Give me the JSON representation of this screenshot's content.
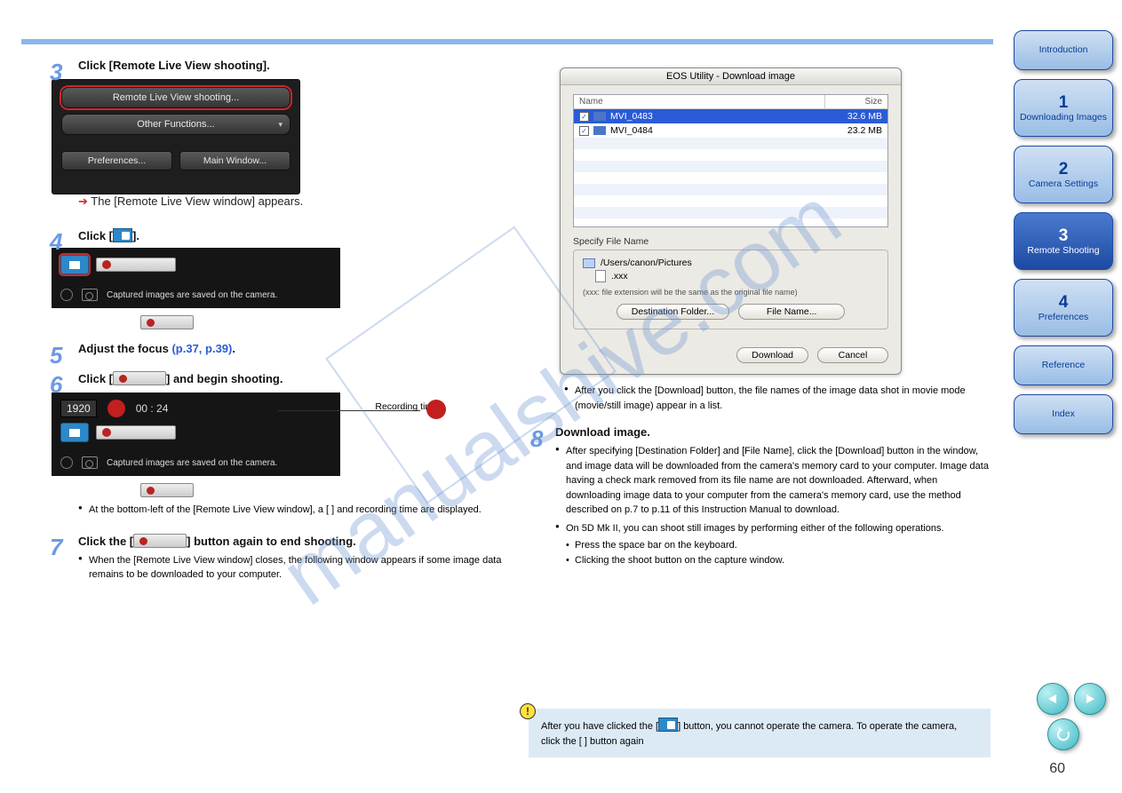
{
  "watermark": "manualshive.com",
  "page_number": "60",
  "sidetabs": [
    {
      "num": "",
      "label": "Introduction"
    },
    {
      "num": "1",
      "label": "Downloading Images"
    },
    {
      "num": "2",
      "label": "Camera Settings"
    },
    {
      "num": "3",
      "label": "Remote Shooting"
    },
    {
      "num": "4",
      "label": "Preferences"
    },
    {
      "num": "",
      "label": "Reference"
    },
    {
      "num": "",
      "label": "Index"
    }
  ],
  "cap_panel": {
    "remote": "Remote Live View shooting...",
    "other": "Other Functions...",
    "prefs": "Preferences...",
    "main": "Main Window..."
  },
  "steps": {
    "s3": {
      "title": "Click [Remote Live View shooting].",
      "after": "The [Remote Live View window] appears."
    },
    "s4": {
      "title_pre": "Click [",
      "title_post": "]."
    },
    "s5": {
      "title_pre": "Adjust the focus ",
      "title_link": "(p.37, p.39)",
      "title_post": "."
    },
    "s6": {
      "title_pre": "Click [",
      "title_post": "] and begin shooting."
    },
    "s7": {
      "title_pre": "Click the [",
      "title_post": "] button again to end shooting."
    },
    "s8": {
      "title": "Download image."
    }
  },
  "rec_panel": {
    "msg": "Captured images are saved on the camera."
  },
  "rec_time": {
    "res": "1920",
    "time": "00 : 24",
    "label": "Recording time"
  },
  "notes6": [
    "At the bottom-left of the [Remote Live View window], a [   ] and recording time are displayed."
  ],
  "notes7": [
    "When the [Remote Live View window] closes, the following window appears if some image data remains to be downloaded to your computer."
  ],
  "notes8": [
    "After you click the [Download] button, the file names of the image data shot in movie mode (movie/still image) appear in a list.",
    "After specifying [Destination Folder] and [File Name], click the [Download] button in the window, and image data will be downloaded from the camera's memory card to your computer. Image data having a check mark removed from its file name are not downloaded. Afterward, when downloading image data to your computer from the camera's memory card, use the method described on p.7 to p.11 of this Instruction Manual to download.",
    "On 5D Mk II, you can shoot still images by performing either of the following operations.",
    "Press the space bar on the keyboard.",
    "Clicking the shoot button on the capture window."
  ],
  "dialog": {
    "title": "EOS Utility - Download image",
    "head_name": "Name",
    "head_size": "Size",
    "rows": [
      {
        "name": "MVI_0483",
        "size": "32.6 MB",
        "sel": true
      },
      {
        "name": "MVI_0484",
        "size": "23.2 MB",
        "sel": false
      }
    ],
    "section": "Specify File Name",
    "path": "/Users/canon/Pictures",
    "ext": ".xxx",
    "note": "(xxx: file extension will be the same as the original file name)",
    "btn_dest": "Destination Folder...",
    "btn_fname": "File Name...",
    "btn_dl": "Download",
    "btn_cancel": "Cancel"
  },
  "warn": {
    "text_pre": "After you have clicked the [",
    "text_post": "] button, you cannot operate the camera. To operate the camera, click the [    ] button again "
  }
}
